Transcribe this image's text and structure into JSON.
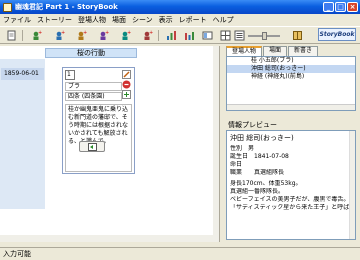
{
  "window": {
    "title": "幽魂君記 Part 1 - StoryBook",
    "minimize": "_",
    "maximize": "□",
    "close": "×"
  },
  "menu": [
    "ファイル",
    "ストーリー",
    "登場人物",
    "場面",
    "シーン",
    "表示",
    "レポート",
    "ヘルプ"
  ],
  "toolbar": {
    "icons": [
      "file-icon",
      "add-person-icon",
      "add-person-icon",
      "add-person-icon",
      "add-person-icon",
      "add-person-icon",
      "chart-icon",
      "chart-icon",
      "view-icon",
      "grid-icon",
      "list-icon",
      "book-icon",
      "zoom-slider"
    ],
    "brand": "StoryBook"
  },
  "timeline": {
    "column_header": "桜の行動",
    "date": "1859-06-01",
    "scene": {
      "chapter_no": "1",
      "person": "ブラ",
      "location": "四条 (四条園)",
      "text": "桂か幽鬼亜鬼に乗り込む新門道の藩邸で、そう時期には根据されないかされても解放される、と識んで。"
    },
    "add_button_icon": "add-icon"
  },
  "right_panel": {
    "tabs": [
      "登場人物",
      "場面",
      "新書き"
    ],
    "characters": [
      {
        "name": "桂 小五郎(ブラ)",
        "selected": false
      },
      {
        "name": "沖田 総司(おっきー)",
        "selected": true
      },
      {
        "name": "神経 (神経丸)(前島)",
        "selected": false
      }
    ],
    "preview_label": "情報プレビュー",
    "preview": {
      "name": "沖田 総司(おっきー)",
      "lines": [
        "性別　男",
        "誕生日　1841-07-08",
        "命日",
        "職業　　真選組隊長"
      ],
      "desc": [
        "身長170cm、体重53kg。",
        "真選組一番隊隊長。",
        "ベビーフェイスの美男子だが、腹黒で毒舌。",
        "「サディスティック星から来た王子」と呼ばれる性格のドS。"
      ]
    }
  },
  "status": "入力可能"
}
